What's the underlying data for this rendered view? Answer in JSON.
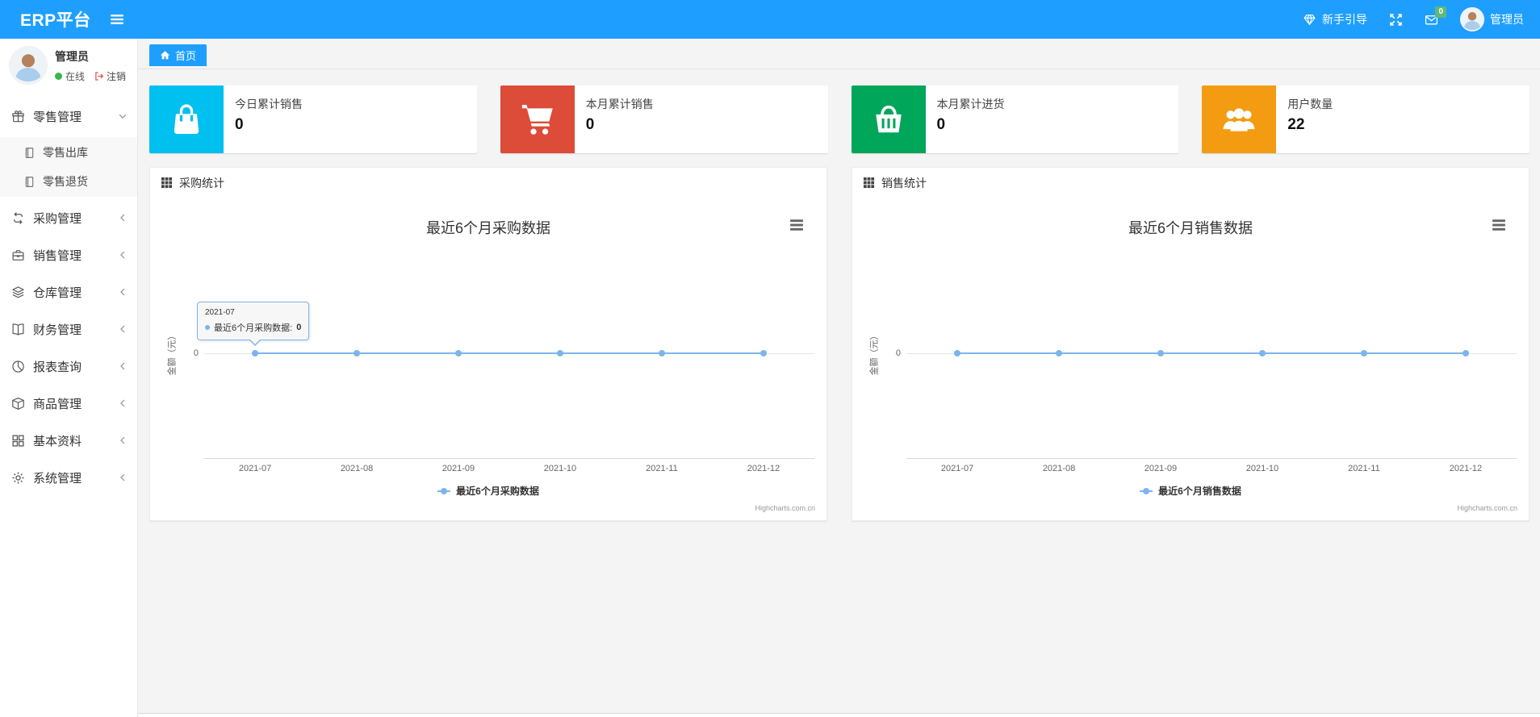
{
  "navbar": {
    "brand": "ERP平台",
    "menu_toggle_icon": "hamburger-icon",
    "color": "#1e9fff",
    "guide": {
      "icon": "gem-icon",
      "label": "新手引导"
    },
    "fullscreen_icon": "fullscreen-icon",
    "messages": {
      "icon": "envelope-icon",
      "badge": "0",
      "badge_color": "#5fb878"
    },
    "user": {
      "avatar_icon": "person-icon",
      "name": "管理员"
    }
  },
  "sidebar": {
    "user": {
      "avatar_icon": "person-icon",
      "name": "管理员",
      "status_dot_color": "#39b54a",
      "status": "在线",
      "logout_icon": "signout-icon",
      "logout": "注销"
    },
    "items": [
      {
        "icon": "gift-icon",
        "label": "零售管理",
        "state": "expanded",
        "children": [
          {
            "icon": "journal-icon",
            "label": "零售出库"
          },
          {
            "icon": "journal-icon",
            "label": "零售退货"
          }
        ]
      },
      {
        "icon": "repeat-icon",
        "label": "采购管理",
        "state": "collapsed"
      },
      {
        "icon": "briefcase-icon",
        "label": "销售管理",
        "state": "collapsed"
      },
      {
        "icon": "layers-icon",
        "label": "仓库管理",
        "state": "collapsed"
      },
      {
        "icon": "book-open-icon",
        "label": "财务管理",
        "state": "collapsed"
      },
      {
        "icon": "pie-chart-icon",
        "label": "报表查询",
        "state": "collapsed"
      },
      {
        "icon": "box-icon",
        "label": "商品管理",
        "state": "collapsed"
      },
      {
        "icon": "grid-icon",
        "label": "基本资料",
        "state": "collapsed"
      },
      {
        "icon": "gear-icon",
        "label": "系统管理",
        "state": "collapsed"
      }
    ]
  },
  "tabs": [
    {
      "icon": "home-icon",
      "label": "首页",
      "active": true
    }
  ],
  "stat_cards": [
    {
      "icon": "bag-icon",
      "color": "#00c0ef",
      "label": "今日累计销售",
      "value": "0"
    },
    {
      "icon": "cart-icon",
      "color": "#dd4b39",
      "label": "本月累计销售",
      "value": "0"
    },
    {
      "icon": "basket-icon",
      "color": "#00a65a",
      "label": "本月累计进货",
      "value": "0"
    },
    {
      "icon": "users-icon",
      "color": "#f39c12",
      "label": "用户数量",
      "value": "22"
    }
  ],
  "chart_data": [
    {
      "type": "line",
      "panel_title": "采购统计",
      "panel_icon": "th-icon",
      "title": "最近6个月采购数据",
      "categories": [
        "2021-07",
        "2021-08",
        "2021-09",
        "2021-10",
        "2021-11",
        "2021-12"
      ],
      "series": [
        {
          "name": "最近6个月采购数据",
          "values": [
            0,
            0,
            0,
            0,
            0,
            0
          ],
          "color": "#7cb5ec"
        }
      ],
      "xlabel": "",
      "ylabel": "金额（元）",
      "yticks": [
        "0"
      ],
      "ylim": [
        0,
        1
      ],
      "grid": false,
      "legend_position": "bottom",
      "credits": "Highcharts.com.cn",
      "tooltip": {
        "visible": true,
        "category": "2021-07",
        "label": "最近6个月采购数据: ",
        "value": "0"
      }
    },
    {
      "type": "line",
      "panel_title": "销售统计",
      "panel_icon": "th-icon",
      "title": "最近6个月销售数据",
      "categories": [
        "2021-07",
        "2021-08",
        "2021-09",
        "2021-10",
        "2021-11",
        "2021-12"
      ],
      "series": [
        {
          "name": "最近6个月销售数据",
          "values": [
            0,
            0,
            0,
            0,
            0,
            0
          ],
          "color": "#7cb5ec"
        }
      ],
      "xlabel": "",
      "ylabel": "金额（元）",
      "yticks": [
        "0"
      ],
      "ylim": [
        0,
        1
      ],
      "grid": false,
      "legend_position": "bottom",
      "credits": "Highcharts.com.cn",
      "tooltip": {
        "visible": false
      }
    }
  ]
}
